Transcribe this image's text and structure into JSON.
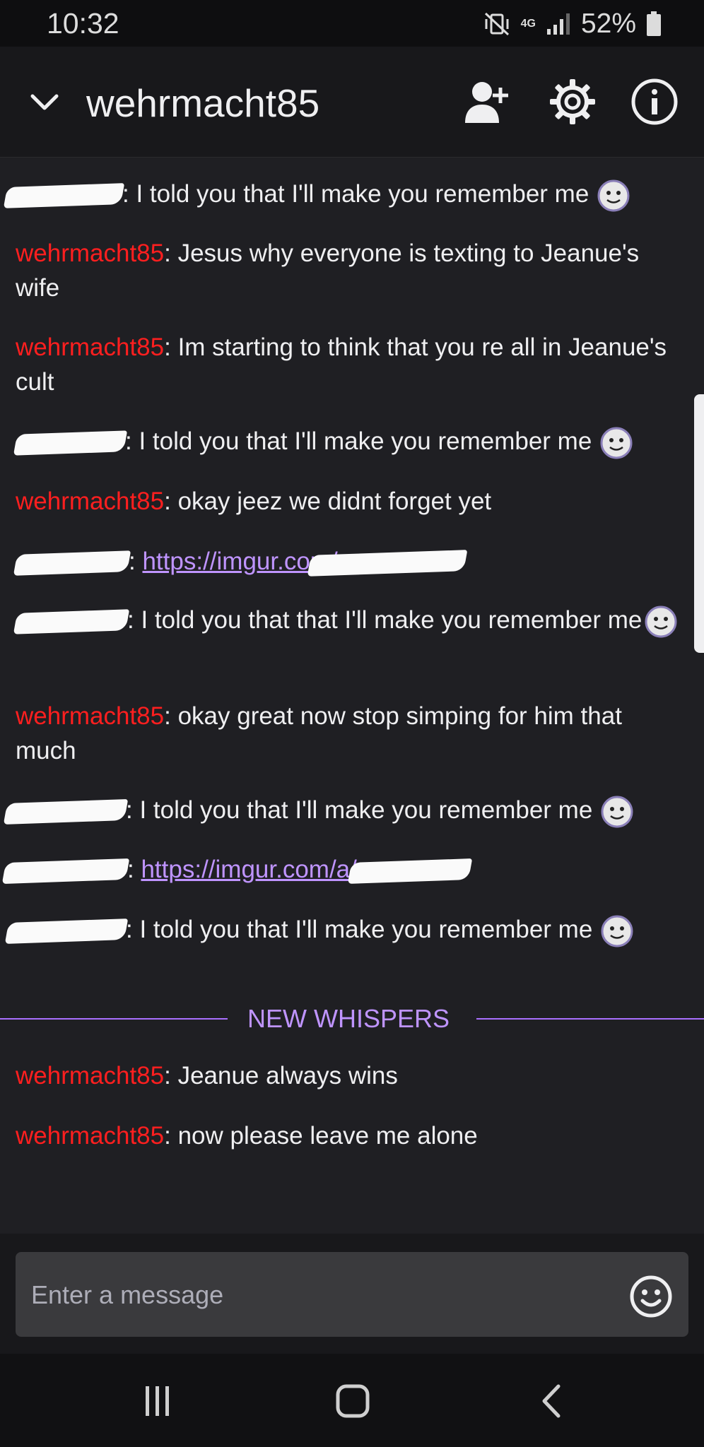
{
  "status_bar": {
    "time": "10:32",
    "network": "4G",
    "battery": "52%"
  },
  "header": {
    "title": "wehrmacht85"
  },
  "messages": [
    {
      "user": "",
      "sep": ":",
      "text": " I told you that I'll make you remember me"
    },
    {
      "user": "wehrmacht85",
      "sep": ":",
      "text": " Jesus why everyone is texting to Jeanue's wife"
    },
    {
      "user": "wehrmacht85",
      "sep": ":",
      "text": " Im starting to think that you re all in Jeanue's cult"
    },
    {
      "user": "",
      "sep": ":",
      "text": " I told you that I'll make you remember me"
    },
    {
      "user": "wehrmacht85",
      "sep": ":",
      "text": " okay jeez we didnt forget yet"
    },
    {
      "user": "",
      "sep": ":",
      "link": "https://imgur.com/"
    },
    {
      "user": "",
      "sep": ":",
      "text": " I told you that that I'll make you remember me"
    },
    {
      "user": "wehrmacht85",
      "sep": ":",
      "text": " okay great now stop simping for him that much"
    },
    {
      "user": "",
      "sep": ":",
      "text": " I told you that I'll make you remember me"
    },
    {
      "user": "",
      "sep": ":",
      "link": "https://imgur.com/a/"
    },
    {
      "user": "",
      "sep": ":",
      "text": " I told you that I'll make you remember me"
    }
  ],
  "divider_label": "NEW WHISPERS",
  "new_messages": [
    {
      "user": "wehrmacht85",
      "sep": ":",
      "text": " Jeanue always wins"
    },
    {
      "user": "wehrmacht85",
      "sep": ":",
      "text": " now please leave me alone"
    }
  ],
  "input": {
    "placeholder": "Enter a message"
  },
  "colors": {
    "username": "#ff1f1f",
    "accent": "#bf94ff",
    "background": "#1f1f23"
  },
  "icons": [
    "chevron-down-icon",
    "add-friend-icon",
    "settings-icon",
    "info-icon",
    "emote-icon",
    "emoji-icon"
  ]
}
